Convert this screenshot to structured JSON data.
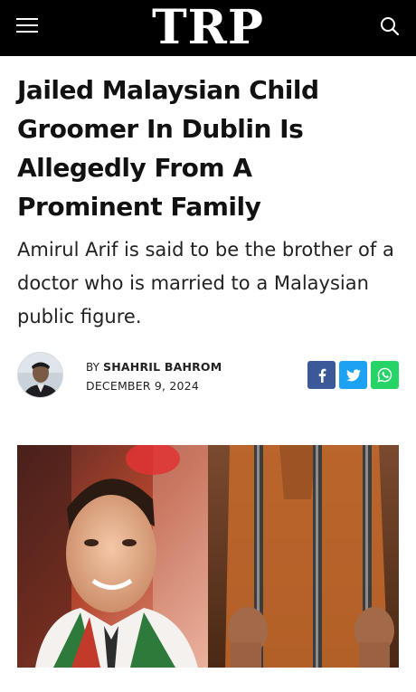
{
  "header": {
    "logo": "TRP",
    "menu_icon": "hamburger-menu-icon",
    "search_icon": "search-icon",
    "background": "#000000"
  },
  "article": {
    "title": "Jailed Malaysian Child Groomer In Dublin Is Allegedly From A Prominent Family",
    "subtitle": "Amirul Arif is said to be the brother of a doctor who is married to a Malaysian public figure.",
    "byline": {
      "prefix": "BY",
      "author": "SHAHRIL BAHROM",
      "date": "DECEMBER 9, 2024"
    },
    "share": {
      "facebook": {
        "icon": "facebook-icon",
        "color": "#3b5998"
      },
      "twitter": {
        "icon": "twitter-icon",
        "color": "#1da1f2"
      },
      "whatsapp": {
        "icon": "whatsapp-icon",
        "color": "#25d366"
      }
    }
  }
}
